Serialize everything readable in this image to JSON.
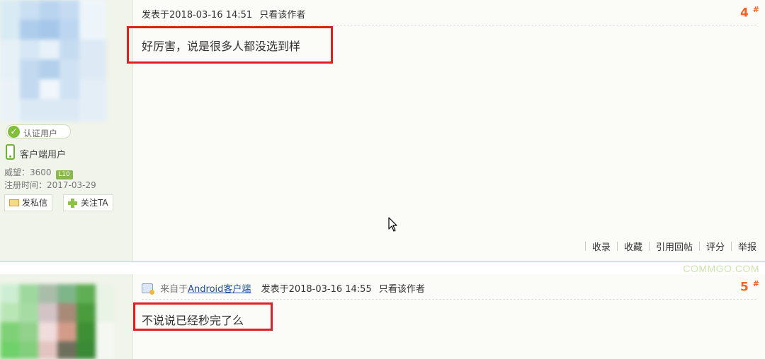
{
  "posts": [
    {
      "user": {
        "stamp": "认证用户",
        "client": "客户端用户",
        "prestige": "威望：3600",
        "level": "L10",
        "registered": "注册时间：2017-03-29",
        "pm_button": "发私信",
        "follow_button": "关注TA"
      },
      "posted": "发表于2018-03-16 14:51",
      "author_only": "只看该作者",
      "floor": "4",
      "floor_mark": "#",
      "content": "好厉害，说是很多人都没选到样",
      "actions": [
        "收录",
        "收藏",
        "引用回帖",
        "评分",
        "举报"
      ]
    },
    {
      "source_prefix": "来自于",
      "source_link": "Android客户端",
      "posted": "发表于2018-03-16 14:55",
      "author_only": "只看该作者",
      "floor": "5",
      "floor_mark": "#",
      "content": "不说说已经秒完了么"
    }
  ],
  "watermark": "COMMGO.COM",
  "colors": {
    "highlight_box": "#e21d1d",
    "floor_number": "#f26522",
    "sidebar_bg": "#f1f4ea",
    "link": "#1f4ea8"
  }
}
